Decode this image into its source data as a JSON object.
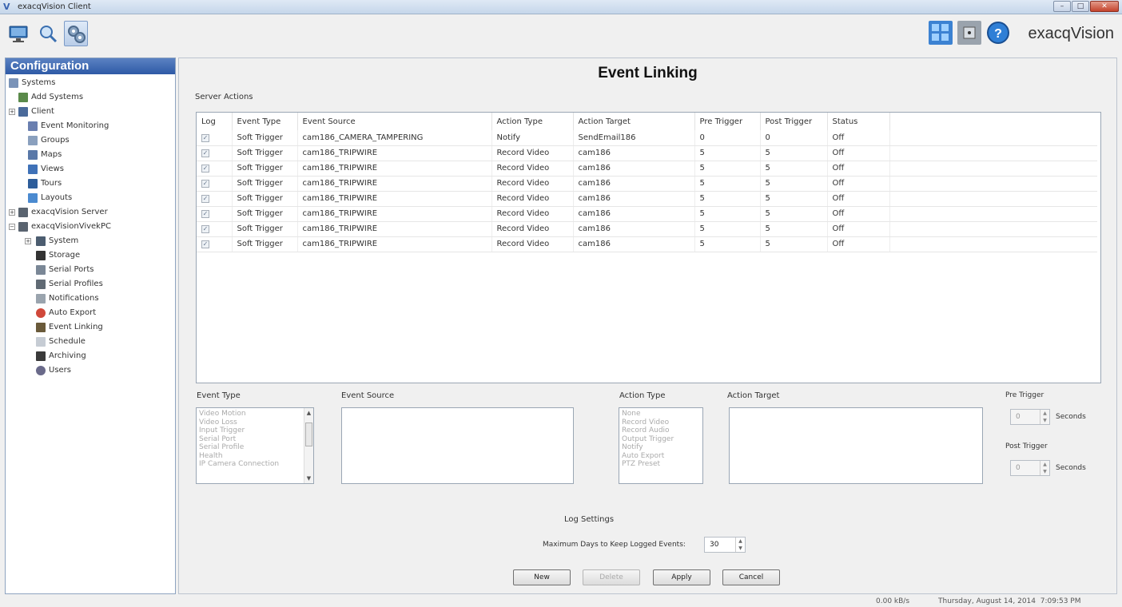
{
  "window": {
    "title": "exacqVision Client"
  },
  "toolbar": {
    "buttons": [
      "live-view-icon",
      "search-icon",
      "config-icon"
    ],
    "brand": "exacqVision",
    "brand_icons": [
      "layout-icon",
      "info-icon",
      "help-icon"
    ]
  },
  "sidebar": {
    "header": "Configuration",
    "items": [
      {
        "label": "Systems"
      },
      {
        "label": "Add Systems"
      },
      {
        "label": "Client"
      },
      {
        "label": "Event Monitoring"
      },
      {
        "label": "Groups"
      },
      {
        "label": "Maps"
      },
      {
        "label": "Views"
      },
      {
        "label": "Tours"
      },
      {
        "label": "Layouts"
      },
      {
        "label": "exacqVision Server"
      },
      {
        "label": "exacqVisionVivekPC"
      },
      {
        "label": "System"
      },
      {
        "label": "Storage"
      },
      {
        "label": "Serial Ports"
      },
      {
        "label": "Serial Profiles"
      },
      {
        "label": "Notifications"
      },
      {
        "label": "Auto Export"
      },
      {
        "label": "Event Linking"
      },
      {
        "label": "Schedule"
      },
      {
        "label": "Archiving"
      },
      {
        "label": "Users"
      }
    ]
  },
  "main": {
    "title": "Event Linking",
    "server_actions_label": "Server Actions",
    "columns": [
      "Log",
      "Event Type",
      "Event Source",
      "Action Type",
      "Action Target",
      "Pre Trigger",
      "Post Trigger",
      "Status"
    ],
    "rows": [
      {
        "event_type": "Soft Trigger",
        "event_source": "cam186_CAMERA_TAMPERING",
        "action_type": "Notify",
        "action_target": "SendEmail186",
        "pre": "0",
        "post": "0",
        "status": "Off"
      },
      {
        "event_type": "Soft Trigger",
        "event_source": "cam186_TRIPWIRE",
        "action_type": "Record Video",
        "action_target": "cam186",
        "pre": "5",
        "post": "5",
        "status": "Off"
      },
      {
        "event_type": "Soft Trigger",
        "event_source": "cam186_TRIPWIRE",
        "action_type": "Record Video",
        "action_target": "cam186",
        "pre": "5",
        "post": "5",
        "status": "Off"
      },
      {
        "event_type": "Soft Trigger",
        "event_source": "cam186_TRIPWIRE",
        "action_type": "Record Video",
        "action_target": "cam186",
        "pre": "5",
        "post": "5",
        "status": "Off"
      },
      {
        "event_type": "Soft Trigger",
        "event_source": "cam186_TRIPWIRE",
        "action_type": "Record Video",
        "action_target": "cam186",
        "pre": "5",
        "post": "5",
        "status": "Off"
      },
      {
        "event_type": "Soft Trigger",
        "event_source": "cam186_TRIPWIRE",
        "action_type": "Record Video",
        "action_target": "cam186",
        "pre": "5",
        "post": "5",
        "status": "Off"
      },
      {
        "event_type": "Soft Trigger",
        "event_source": "cam186_TRIPWIRE",
        "action_type": "Record Video",
        "action_target": "cam186",
        "pre": "5",
        "post": "5",
        "status": "Off"
      },
      {
        "event_type": "Soft Trigger",
        "event_source": "cam186_TRIPWIRE",
        "action_type": "Record Video",
        "action_target": "cam186",
        "pre": "5",
        "post": "5",
        "status": "Off"
      }
    ],
    "editor": {
      "event_type_label": "Event Type",
      "event_types": [
        "Video Motion",
        "Video Loss",
        "Input Trigger",
        "Serial Port",
        "Serial Profile",
        "Health",
        "IP Camera Connection"
      ],
      "event_source_label": "Event Source",
      "action_type_label": "Action Type",
      "action_types": [
        "None",
        "Record Video",
        "Record Audio",
        "Output Trigger",
        "Notify",
        "Auto Export",
        "PTZ Preset"
      ],
      "action_target_label": "Action Target",
      "pre_trigger_label": "Pre Trigger",
      "pre_trigger_value": "0",
      "post_trigger_label": "Post Trigger",
      "post_trigger_value": "0",
      "seconds_label": "Seconds"
    },
    "log_settings": {
      "label": "Log Settings",
      "max_days_label": "Maximum Days to Keep Logged Events:",
      "max_days_value": "30"
    },
    "buttons": {
      "new": "New",
      "delete": "Delete",
      "apply": "Apply",
      "cancel": "Cancel"
    }
  },
  "status": {
    "rate": "0.00 kB/s",
    "datetime": "Thursday, August 14, 2014  7:09:53 PM"
  },
  "colors": {
    "accent": "#2e5aa6",
    "titlebar": "#c5d6ea",
    "close": "#c4432c"
  }
}
